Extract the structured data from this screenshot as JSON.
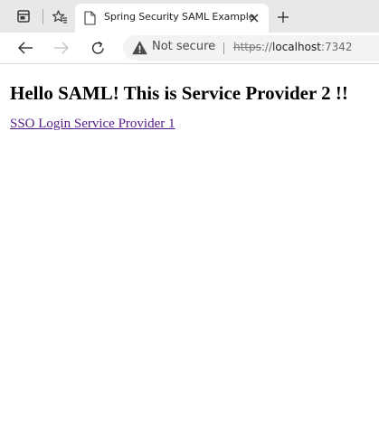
{
  "browser": {
    "tab": {
      "title": "Spring Security SAML Example",
      "icon": "page-icon",
      "close_icon": "close-icon"
    },
    "tabstrip": {
      "tab_actions_icon": "tab-actions-icon",
      "favorites_icon": "favorites-icon",
      "new_tab_icon": "plus-icon"
    },
    "toolbar": {
      "back_icon": "back-arrow-icon",
      "forward_icon": "forward-arrow-icon",
      "refresh_icon": "refresh-icon"
    },
    "address_bar": {
      "security_icon": "warning-icon",
      "security_label": "Not secure",
      "url_scheme": "https",
      "url_separator": "://",
      "url_host": "localhost",
      "url_port": ":7342"
    }
  },
  "page": {
    "heading": "Hello SAML! This is Service Provider 2 !!",
    "sso_link": "SSO Login Service Provider 1"
  },
  "colors": {
    "tabstrip_bg": "#e8e8e8",
    "link_visited": "#551a8b",
    "text": "#000000"
  }
}
